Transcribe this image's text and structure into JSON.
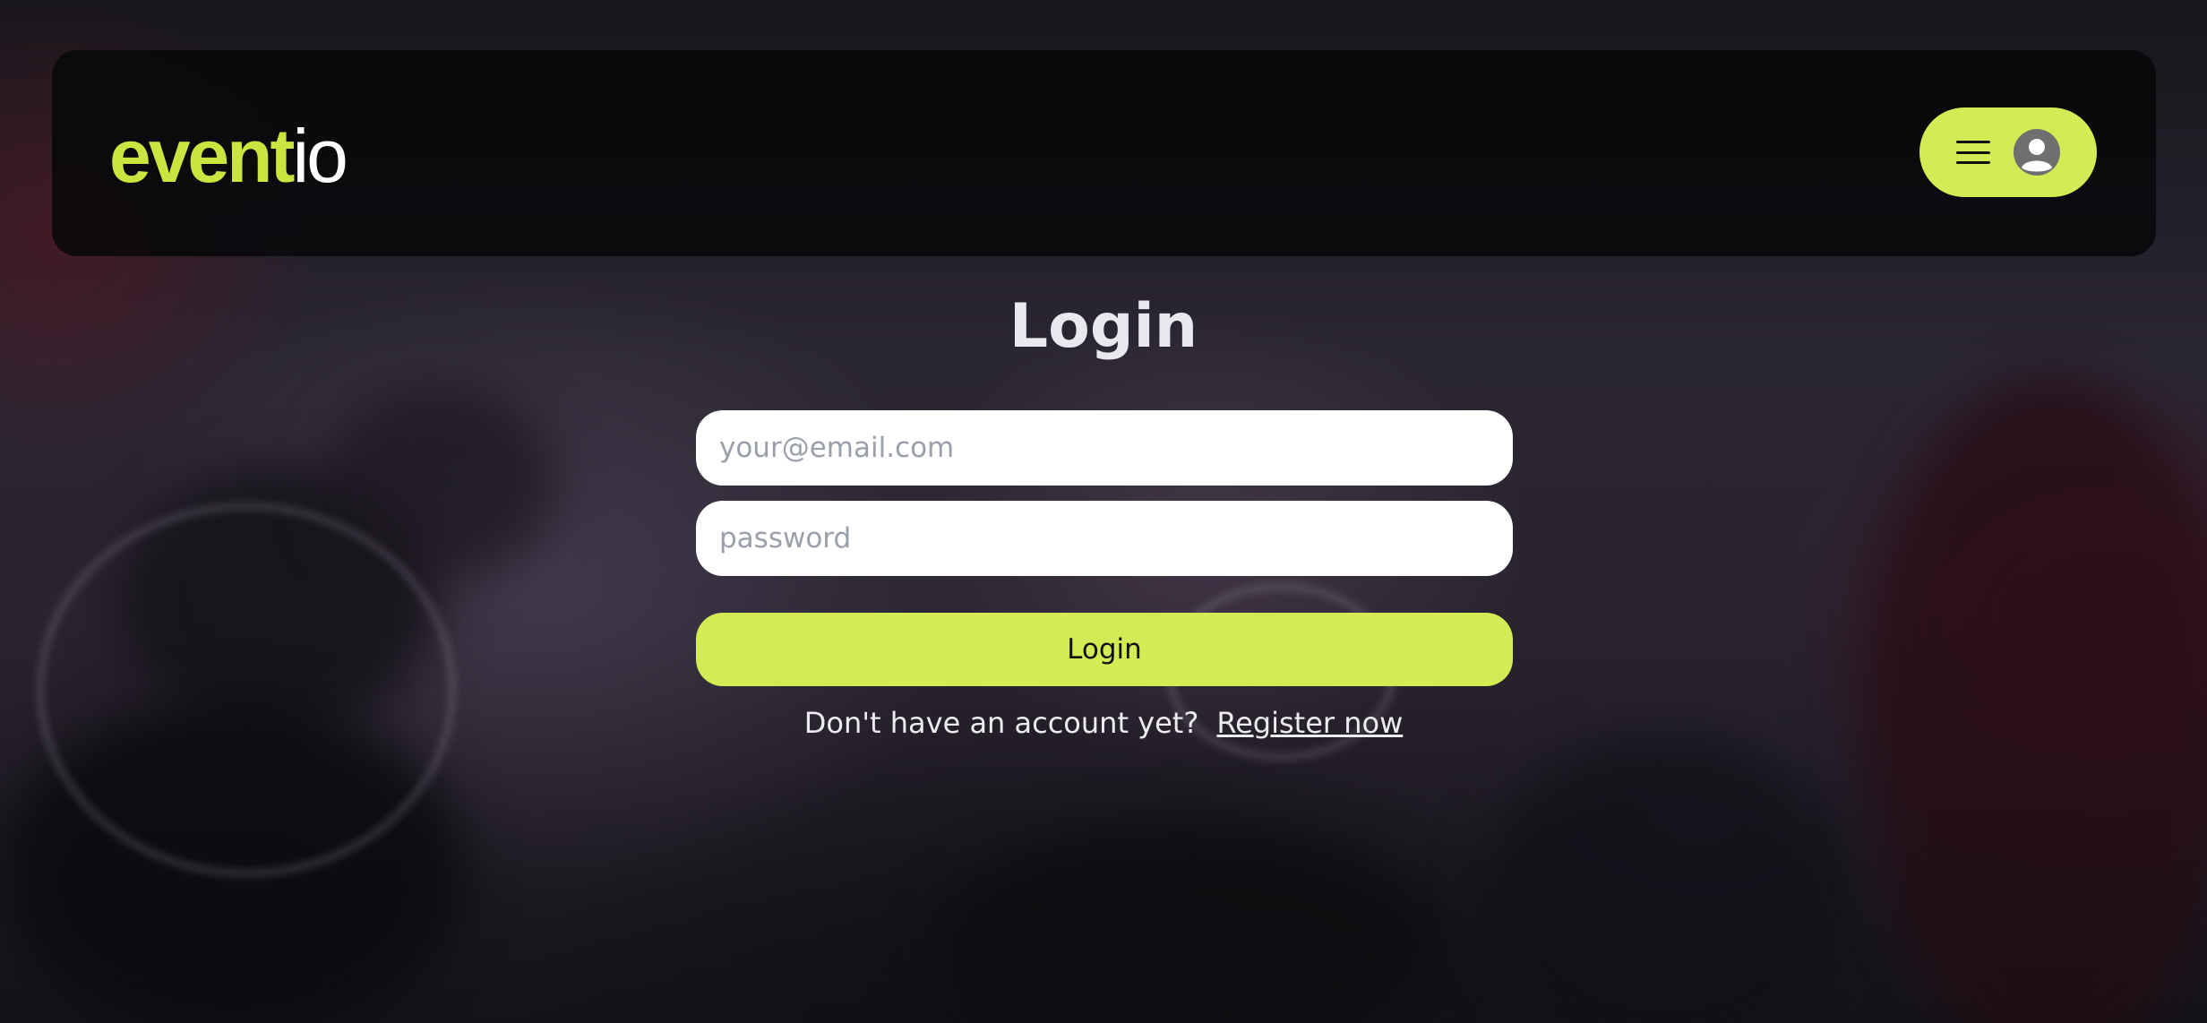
{
  "brand": {
    "logo_main": "event",
    "logo_tail": "io",
    "accent_color": "#d3ec55"
  },
  "header": {
    "menu_icon": "hamburger-menu-icon",
    "avatar_icon": "user-avatar-icon"
  },
  "login_form": {
    "title": "Login",
    "email_placeholder": "your@email.com",
    "email_value": "",
    "password_placeholder": "password",
    "password_value": "",
    "submit_label": "Login",
    "no_account_text": "Don't have an account yet?",
    "register_link_label": "Register now"
  }
}
